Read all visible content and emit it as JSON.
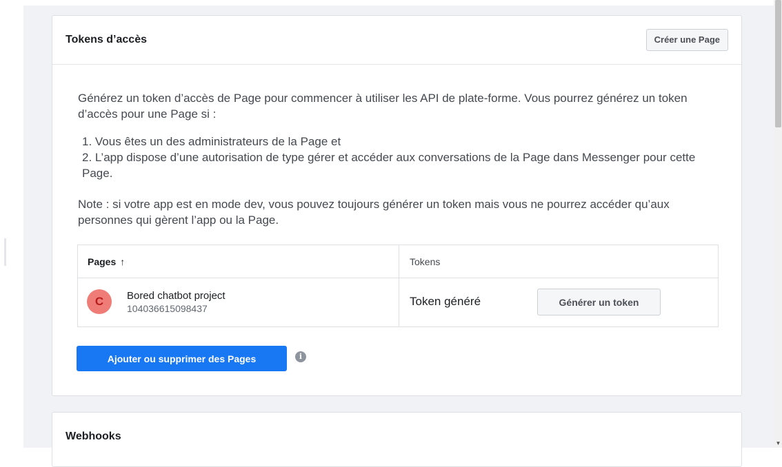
{
  "tokens_section": {
    "title": "Tokens d’accès",
    "create_page_label": "Créer une Page",
    "intro": "Générez un token d’accès de Page pour commencer à utiliser les API de plate-forme. Vous pourrez générez un token d’accès pour une Page si :",
    "conditions": [
      "1. Vous êtes un des administrateurs de la Page et",
      "2. L’app dispose d’une autorisation de type gérer et accéder aux conversations de la Page dans Messenger pour cette Page."
    ],
    "note": "Note : si votre app est en mode dev, vous pouvez toujours générer un token mais vous ne pourrez accéder qu’aux personnes qui gèrent l’app ou la Page.",
    "table": {
      "header_pages": "Pages",
      "sort_arrow": "↑",
      "header_tokens": "Tokens",
      "rows": [
        {
          "avatar_letter": "C",
          "avatar_color": "#f07c77",
          "page_name": "Bored chatbot project",
          "page_id": "104036615098437",
          "token_status": "Token généré",
          "generate_label": "Générer un token"
        }
      ]
    },
    "add_pages_label": "Ajouter ou supprimer des Pages",
    "info_icon_glyph": "i"
  },
  "webhooks_section": {
    "title": "Webhooks"
  },
  "colors": {
    "primary_button": "#1877f2",
    "page_background": "#f0f2f5"
  }
}
